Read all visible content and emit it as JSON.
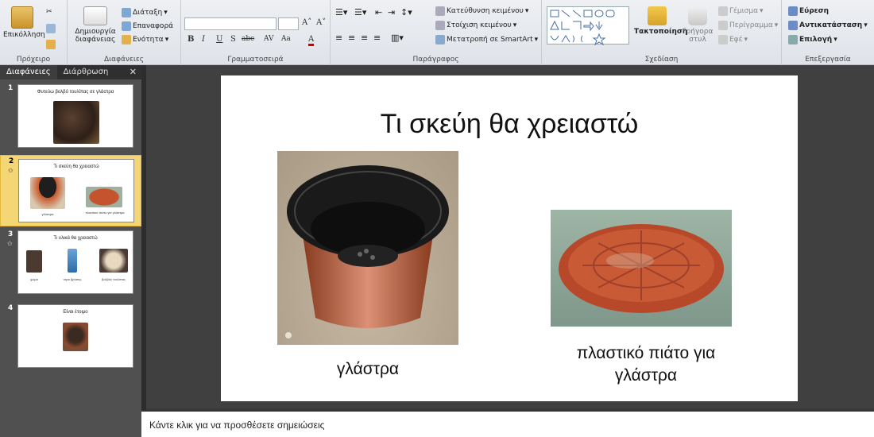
{
  "ribbon": {
    "clipboard": {
      "paste": "Επικόλληση",
      "label": "Πρόχειρο"
    },
    "slides": {
      "new_slide_line1": "Δημιουργία",
      "new_slide_line2": "διαφάνειας",
      "layout": "Διάταξη",
      "reset": "Επαναφορά",
      "section": "Ενότητα",
      "label": "Διαφάνειες"
    },
    "font": {
      "label": "Γραμματοσειρά",
      "buttons": [
        "B",
        "I",
        "U",
        "S",
        "abc",
        "AV",
        "Aa",
        "A"
      ]
    },
    "paragraph": {
      "text_direction": "Κατεύθυνση κειμένου",
      "align_text": "Στοίχιση κειμένου",
      "smartart": "Μετατροπή σε SmartArt",
      "label": "Παράγραφος"
    },
    "drawing": {
      "arrange": "Τακτοποίηση",
      "quick_styles_line1": "Γρήγορα",
      "quick_styles_line2": "στυλ",
      "fill": "Γέμισμα",
      "outline": "Περίγραμμα",
      "effects": "Εφέ",
      "label": "Σχεδίαση"
    },
    "editing": {
      "find": "Εύρεση",
      "replace": "Αντικατάσταση",
      "select": "Επιλογή",
      "label": "Επεξεργασία"
    }
  },
  "panel": {
    "tab_slides": "Διαφάνειες",
    "tab_outline": "Διάρθρωση",
    "close": "✕"
  },
  "thumbnails": [
    {
      "num": "1",
      "title": "Φυτεύω βολβό τουλίπας σε γλάστρα"
    },
    {
      "num": "2",
      "title": "Τι σκεύη θα χρειαστώ",
      "cap1": "γλάστρα",
      "cap2": "πλαστικό πιάτο για γλάστρα"
    },
    {
      "num": "3",
      "title": "Τι υλικά θα χρειαστώ",
      "cap1": "χώμα",
      "cap2": "νερό βρύσης",
      "cap3": "βολβός τουλίπας"
    },
    {
      "num": "4",
      "title": "Είναι έτοιμο"
    }
  ],
  "slide": {
    "title": "Τι σκεύη θα χρειαστώ",
    "caption1": "γλάστρα",
    "caption2_line1": "πλαστικό πιάτο για",
    "caption2_line2": "γλάστρα"
  },
  "notes": {
    "placeholder": "Κάντε κλικ για να προσθέσετε σημειώσεις"
  }
}
